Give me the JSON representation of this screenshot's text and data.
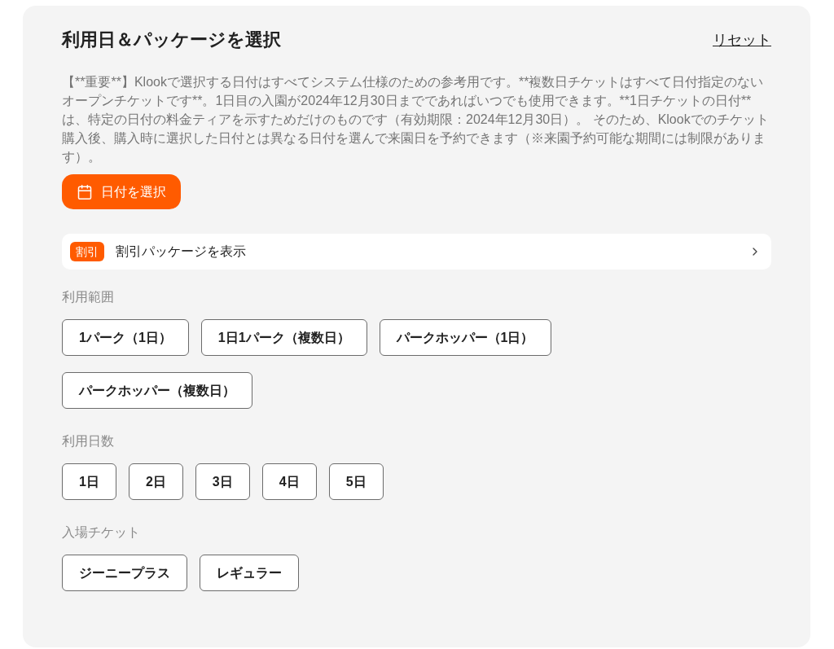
{
  "header": {
    "title": "利用日＆パッケージを選択",
    "reset_link": "リセット"
  },
  "notice": "【**重要**】Klookで選択する日付はすべてシステム仕様のための参考用です。**複数日チケットはすべて日付指定のないオープンチケットです**。1日目の入園が2024年12月30日までであればいつでも使用できます。**1日チケットの日付**は、特定の日付の料金ティアを示すためだけのものです（有効期限：2024年12月30日）。 そのため、Klookでのチケット購入後、購入時に選択した日付とは異なる日付を選んで来園日を予約できます（※来園予約可能な期間には制限があります）。",
  "date_button": {
    "label": "日付を選択"
  },
  "discount_row": {
    "badge": "割引",
    "label": "割引パッケージを表示"
  },
  "option_groups": [
    {
      "label": "利用範囲",
      "options": [
        {
          "label": "1パーク（1日）",
          "selected": false
        },
        {
          "label": "1日1パーク（複数日）",
          "selected": false
        },
        {
          "label": "パークホッパー（1日）",
          "selected": false
        },
        {
          "label": "パークホッパー（複数日）",
          "selected": false
        }
      ]
    },
    {
      "label": "利用日数",
      "options": [
        {
          "label": "1日",
          "selected": false
        },
        {
          "label": "2日",
          "selected": false
        },
        {
          "label": "3日",
          "selected": false
        },
        {
          "label": "4日",
          "selected": false
        },
        {
          "label": "5日",
          "selected": false
        }
      ]
    },
    {
      "label": "入場チケット",
      "options": [
        {
          "label": "ジーニープラス",
          "selected": false
        },
        {
          "label": "レギュラー",
          "selected": false
        }
      ]
    }
  ]
}
